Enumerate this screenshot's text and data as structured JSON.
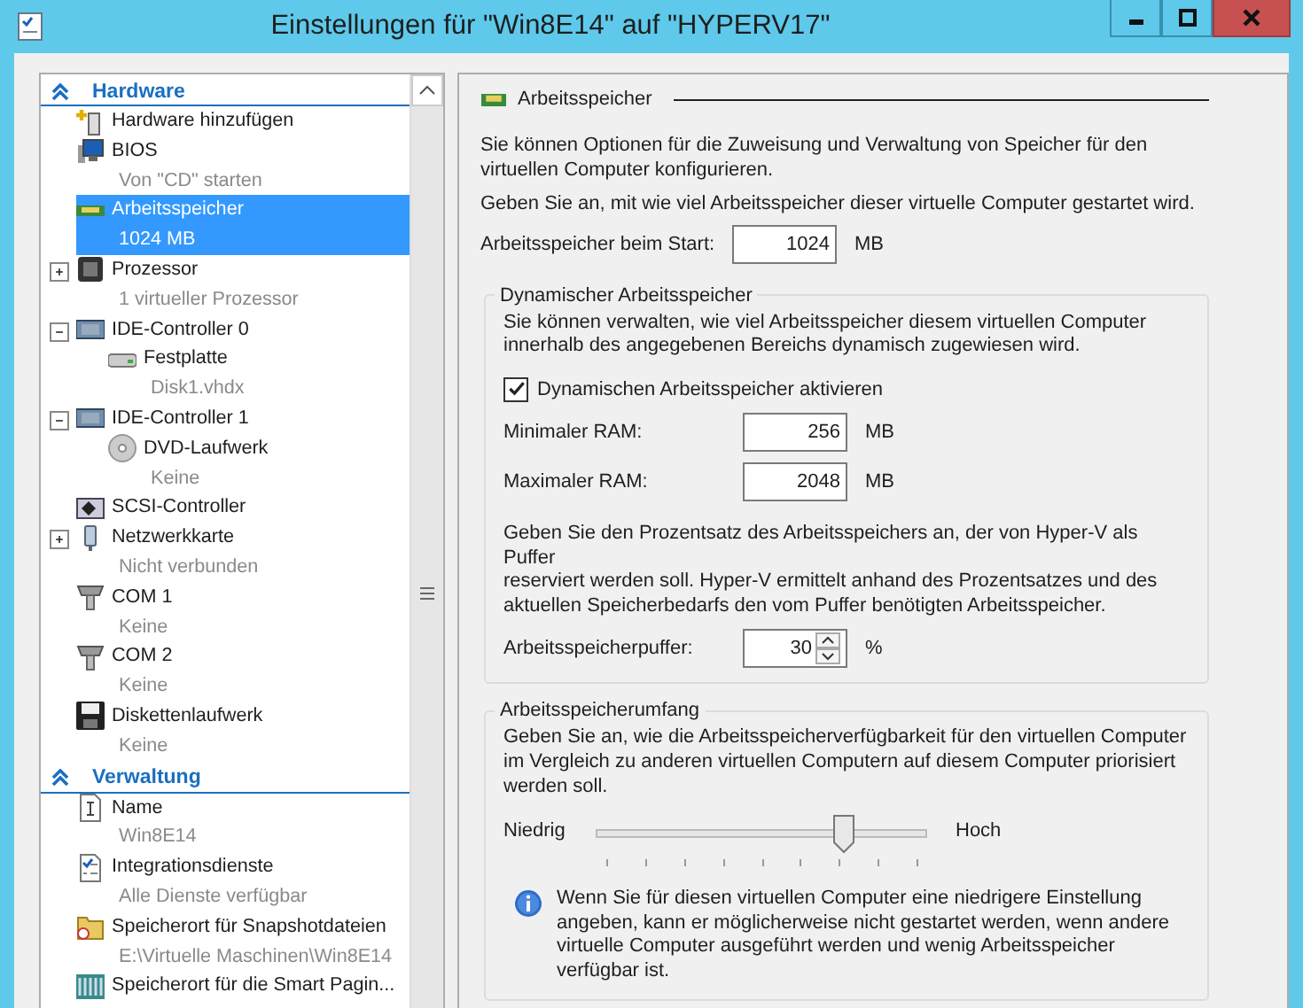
{
  "window": {
    "title": "Einstellungen für \"Win8E14\" auf \"HYPERV17\""
  },
  "sidebar": {
    "sections": [
      {
        "title": "Hardware",
        "expanded": true,
        "items": [
          {
            "kind": "add",
            "label": "Hardware hinzufügen",
            "selected": false
          },
          {
            "kind": "bios",
            "label": "BIOS",
            "detail": "Von \"CD\" starten",
            "selected": false
          },
          {
            "kind": "memory",
            "label": "Arbeitsspeicher",
            "detail": "1024 MB",
            "selected": true
          },
          {
            "kind": "cpu",
            "label": "Prozessor",
            "detail": "1 virtueller Prozessor",
            "selected": false,
            "expanded": false
          },
          {
            "kind": "controller",
            "label": "IDE-Controller 0",
            "selected": false,
            "expanded": true,
            "children": [
              {
                "kind": "disk",
                "label": "Festplatte",
                "detail": "Disk1.vhdx",
                "selected": false
              }
            ]
          },
          {
            "kind": "controller",
            "label": "IDE-Controller 1",
            "selected": false,
            "expanded": true,
            "children": [
              {
                "kind": "dvd",
                "label": "DVD-Laufwerk",
                "detail": "Keine",
                "selected": false
              }
            ]
          },
          {
            "kind": "scsi",
            "label": "SCSI-Controller",
            "selected": false
          },
          {
            "kind": "network",
            "label": "Netzwerkkarte",
            "detail": "Nicht verbunden",
            "selected": false,
            "expanded": false
          },
          {
            "kind": "com",
            "label": "COM 1",
            "detail": "Keine",
            "selected": false
          },
          {
            "kind": "com",
            "label": "COM 2",
            "detail": "Keine",
            "selected": false
          },
          {
            "kind": "floppy",
            "label": "Diskettenlaufwerk",
            "detail": "Keine",
            "selected": false
          }
        ]
      },
      {
        "title": "Verwaltung",
        "expanded": true,
        "items": [
          {
            "kind": "name",
            "label": "Name",
            "detail": "Win8E14",
            "selected": false
          },
          {
            "kind": "integration",
            "label": "Integrationsdienste",
            "detail": "Alle Dienste verfügbar",
            "selected": false
          },
          {
            "kind": "folder",
            "label": "Speicherort für Snapshotdateien",
            "detail": "E:\\Virtuelle Maschinen\\Win8E14",
            "selected": false
          },
          {
            "kind": "paging",
            "label": "Speicherort für die Smart Pagin...",
            "selected": false
          }
        ]
      }
    ]
  },
  "memory_panel": {
    "title": "Arbeitsspeicher",
    "intro": "Sie können Optionen für die Zuweisung und Verwaltung von Speicher für den\nvirtuellen Computer konfigurieren.",
    "startup_hint": "Geben Sie an, mit wie viel Arbeitsspeicher dieser virtuelle Computer gestartet wird.",
    "startup_ram": {
      "label": "Arbeitsspeicher beim Start:",
      "value": "1024",
      "unit": "MB"
    },
    "dynamic": {
      "legend": "Dynamischer Arbeitsspeicher",
      "text": "Sie können verwalten, wie viel Arbeitsspeicher diesem virtuellen Computer\ninnerhalb des angegebenen Bereichs dynamisch zugewiesen wird.",
      "enable": {
        "label": "Dynamischen Arbeitsspeicher aktivieren",
        "checked": true
      },
      "fields": [
        {
          "label": "Minimaler RAM:",
          "value": "256",
          "unit": "MB"
        },
        {
          "label": "Maximaler RAM:",
          "value": "2048",
          "unit": "MB"
        }
      ],
      "buffer_text": "Geben Sie den Prozentsatz des Arbeitsspeichers an, der von Hyper-V als Puffer\nreserviert werden soll. Hyper-V ermittelt anhand des Prozentsatzes und des\naktuellen Speicherbedarfs den vom Puffer benötigten Arbeitsspeicher.",
      "buffer": {
        "label": "Arbeitsspeicherpuffer:",
        "value": "30",
        "unit": "%"
      }
    },
    "weight": {
      "legend": "Arbeitsspeicherumfang",
      "text": "Geben Sie an, wie die Arbeitsspeicherverfügbarkeit für den virtuellen Computer\nim Vergleich zu anderen virtuellen Computern auf diesem Computer priorisiert\nwerden soll.",
      "low_label": "Niedrig",
      "high_label": "Hoch",
      "level": 0.75,
      "info": "Wenn Sie für diesen virtuellen Computer eine niedrigere Einstellung\nangeben, kann er möglicherweise nicht gestartet werden, wenn andere\nvirtuelle Computer ausgeführt werden und wenig Arbeitsspeicher\nverfügbar ist."
    }
  }
}
